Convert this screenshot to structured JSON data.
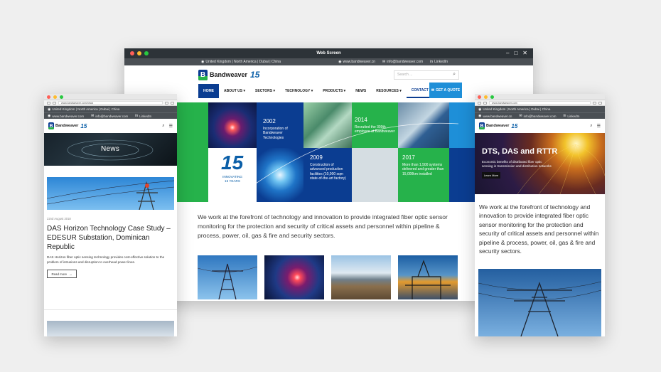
{
  "main": {
    "title": "Web Screen",
    "infobar": {
      "locations": "United Kingdom | North America | Dubai | China",
      "website": "www.bandweaver.cn",
      "email": "info@bandweaver.com",
      "social": "LinkedIn"
    },
    "logo": {
      "name": "Bandweaver",
      "anniversary": "15"
    },
    "search": {
      "placeholder": "Search ..."
    },
    "nav": [
      "HOME",
      "ABOUT US",
      "SECTORS",
      "TECHNOLOGY",
      "PRODUCTS",
      "NEWS",
      "RESOURCES",
      "CONTACT"
    ],
    "nav_dropdowns": [
      "",
      "▾",
      "▾",
      "▾",
      "▾",
      "",
      "▾",
      ""
    ],
    "quote_label": "GET A QUOTE",
    "timeline": [
      {
        "year": "2002",
        "text": "Incorporation of Bandweaver Technologies"
      },
      {
        "year": "2014",
        "text": "Recruited the 300th employee at Bandweaver"
      },
      {
        "year": "2009",
        "text": "Construction of advanced production facilities (10,000 sqm state-of-the-art factory)"
      },
      {
        "year": "2017",
        "text": "More than 1,500 systems delivered and greater than 15,000km installed"
      }
    ],
    "badge": {
      "number": "15",
      "line1": "INNOVATING",
      "line2": "15 YEARS"
    },
    "intro": "We work at the forefront of technology and innovation to provide integrated fiber optic sensor monitoring for the protection and security of critical assets and personnel within pipeline & process, power, oil, gas & fire and security sectors."
  },
  "left": {
    "url": "www.bandweaver.com/news",
    "infobar": {
      "locations": "United Kingdom | North America | Dubai | China",
      "website": "www.bandweaver.com",
      "email": "info@bandweaver.com",
      "social": "LinkedIn"
    },
    "banner": "News",
    "date": "22nd August 2018",
    "article_title": "DAS Horizon Technology Case Study – EDESUR Substation, Dominican Republic",
    "excerpt": "DAS Horizon fiber optic sensing technology provides cost-effective solution to the problem of intrusions and disruption to overhead power lines.",
    "read_more": "Read more",
    "read_more_arrow": "→"
  },
  "right": {
    "url": "www.bandweaver.com",
    "infobar": {
      "locations": "United Kingdom | North America | Dubai | China",
      "website": "www.bandweaver.cn",
      "email": "info@bandweaver.com",
      "social": "LinkedIn"
    },
    "hero_title": "DTS, DAS and RTTR",
    "hero_sub": "Economic benefits of distributed fiber optic sensing in transmission and distribution networks",
    "hero_button": "Learn More",
    "intro": "We work at the forefront of technology and innovation to provide integrated fiber optic sensor monitoring for the protection and security of critical assets and personnel within pipeline & process, power, oil, gas & fire and security sectors."
  },
  "icons": {
    "location": "◉",
    "mail": "✉",
    "linkedin": "in",
    "search": "⌕",
    "menu": "☰",
    "minimize": "–",
    "maximize": "□",
    "close": "✕"
  },
  "colors": {
    "brand_blue": "#0b3d91",
    "brand_green": "#26b24b",
    "accent_blue": "#1e8fd8",
    "chrome_dark": "#2d3338"
  }
}
